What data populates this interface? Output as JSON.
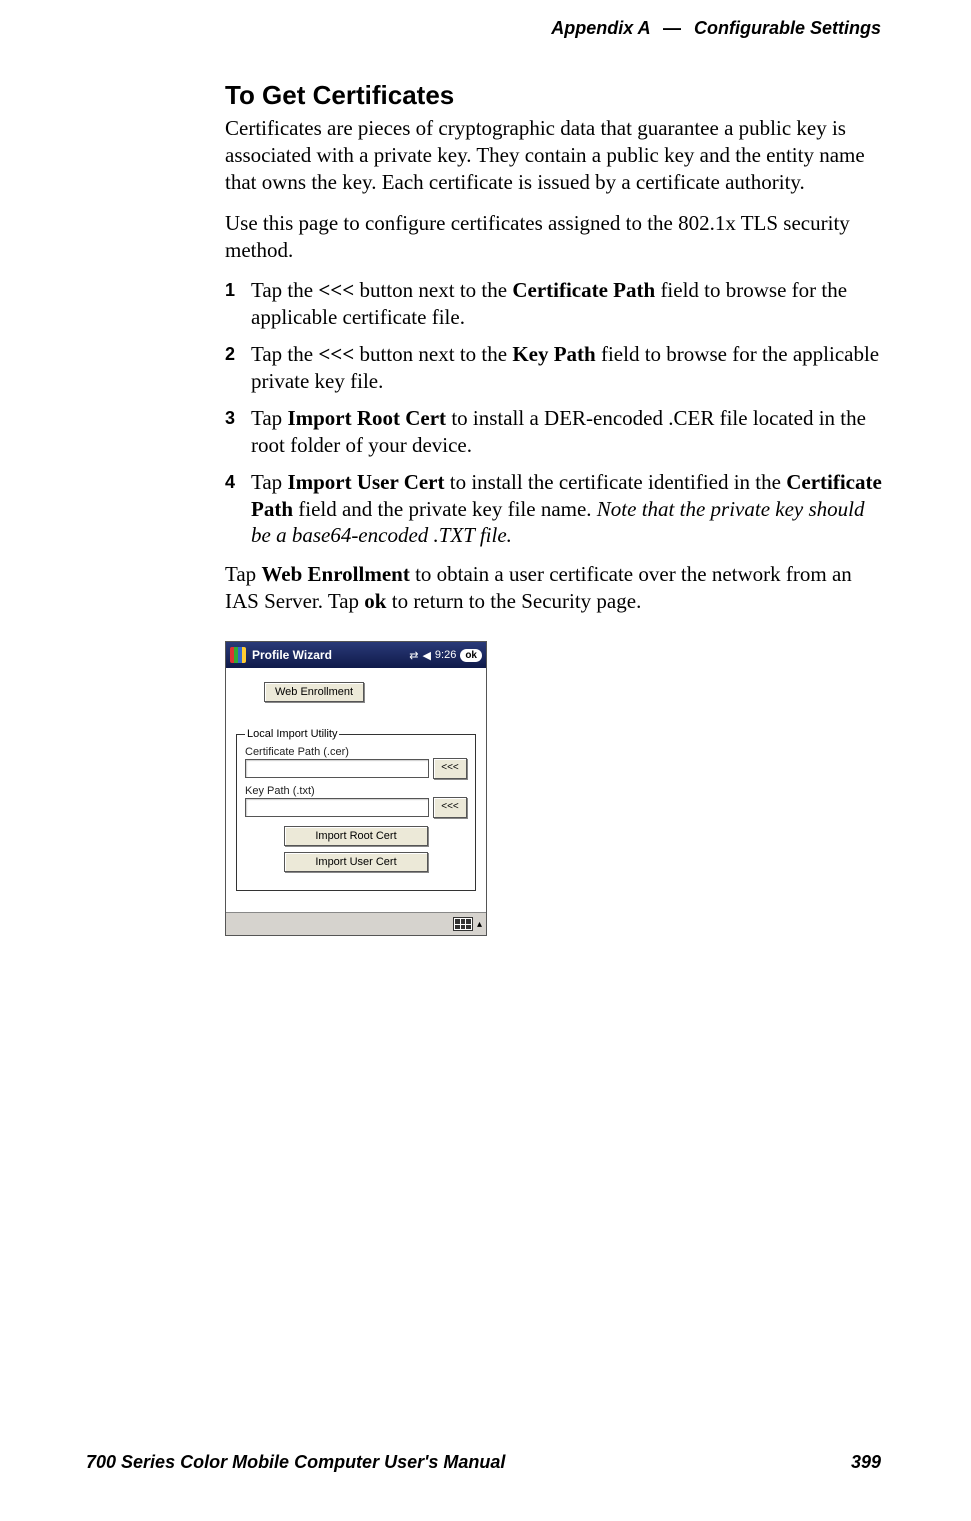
{
  "header": {
    "appendix": "Appendix A",
    "separator": "—",
    "section": "Configurable Settings"
  },
  "title": "To Get Certificates",
  "para1": "Certificates are pieces of cryptographic data that guarantee a public key is associated with a private key. They contain a public key and the entity name that owns the key. Each certificate is issued by a certificate authority.",
  "para2": "Use this page to configure certificates assigned to the 802.1x TLS security method.",
  "steps": [
    {
      "num": "1",
      "pre": "Tap the ",
      "bold1": "<<<",
      "mid1": " button next to the ",
      "bold2": "Certificate Path",
      "post": " field to browse for the applicable certificate file."
    },
    {
      "num": "2",
      "pre": "Tap the ",
      "bold1": "<<<",
      "mid1": " button next to the ",
      "bold2": "Key Path",
      "post": " field to browse for the applicable private key file."
    },
    {
      "num": "3",
      "pre": "Tap ",
      "bold1": "Import Root Cert",
      "mid1": " to install a DER-encoded .CER file located in the root folder of your device.",
      "bold2": "",
      "post": ""
    },
    {
      "num": "4",
      "pre": "Tap ",
      "bold1": "Import User Cert",
      "mid1": " to install the certificate identified in the ",
      "bold2": "Certificate Path",
      "post_pre_italic": " field and the private key file name. ",
      "italic": "Note that the private key should be a base64-encoded .TXT file.",
      "post": ""
    }
  ],
  "closing": {
    "pre": "Tap ",
    "bold1": "Web Enrollment",
    "mid": " to obtain a user certificate over the network from an IAS Server. Tap ",
    "bold2": "ok",
    "post": " to return to the Security page."
  },
  "pda": {
    "title": "Profile Wizard",
    "time": "9:26",
    "ok": "ok",
    "web_enrollment": "Web Enrollment",
    "legend": "Local Import Utility",
    "cert_label": "Certificate Path (.cer)",
    "key_label": "Key Path (.txt)",
    "browse": "<<<",
    "import_root": "Import Root Cert",
    "import_user": "Import User Cert"
  },
  "footer": {
    "left": "700 Series Color Mobile Computer User's Manual",
    "right": "399"
  }
}
